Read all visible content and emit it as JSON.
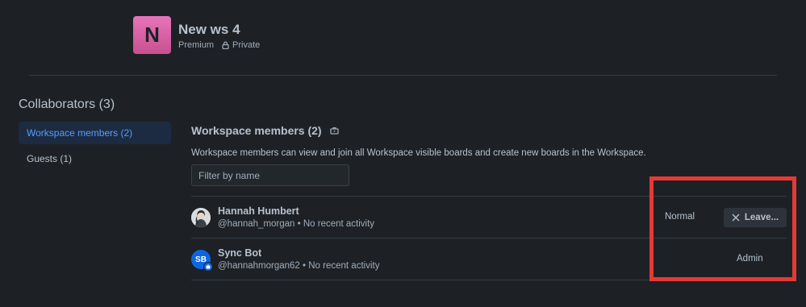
{
  "workspace": {
    "initial": "N",
    "name": "New ws 4",
    "plan": "Premium",
    "visibility": "Private",
    "logo_color": "#d862a4"
  },
  "sidebar": {
    "title": "Collaborators (3)",
    "items": [
      {
        "label": "Workspace members (2)",
        "active": true
      },
      {
        "label": "Guests (1)",
        "active": false
      }
    ]
  },
  "main": {
    "title": "Workspace members (2)",
    "description": "Workspace members can view and join all Workspace visible boards and create new boards in the Workspace.",
    "filter_placeholder": "Filter by name"
  },
  "members": [
    {
      "name": "Hannah Humbert",
      "handle": "@hannah_morgan",
      "activity": "No recent activity",
      "sub": "@hannah_morgan • No recent activity",
      "role": "Normal",
      "action": "Leave..."
    },
    {
      "name": "Sync Bot",
      "initials": "SB",
      "handle": "@hannahmorgan62",
      "activity": "No recent activity",
      "sub": "@hannahmorgan62 • No recent activity",
      "role": "Admin"
    }
  ],
  "colors": {
    "background": "#1d2125",
    "accent": "#579dff",
    "highlight_annotation": "#e53935"
  }
}
